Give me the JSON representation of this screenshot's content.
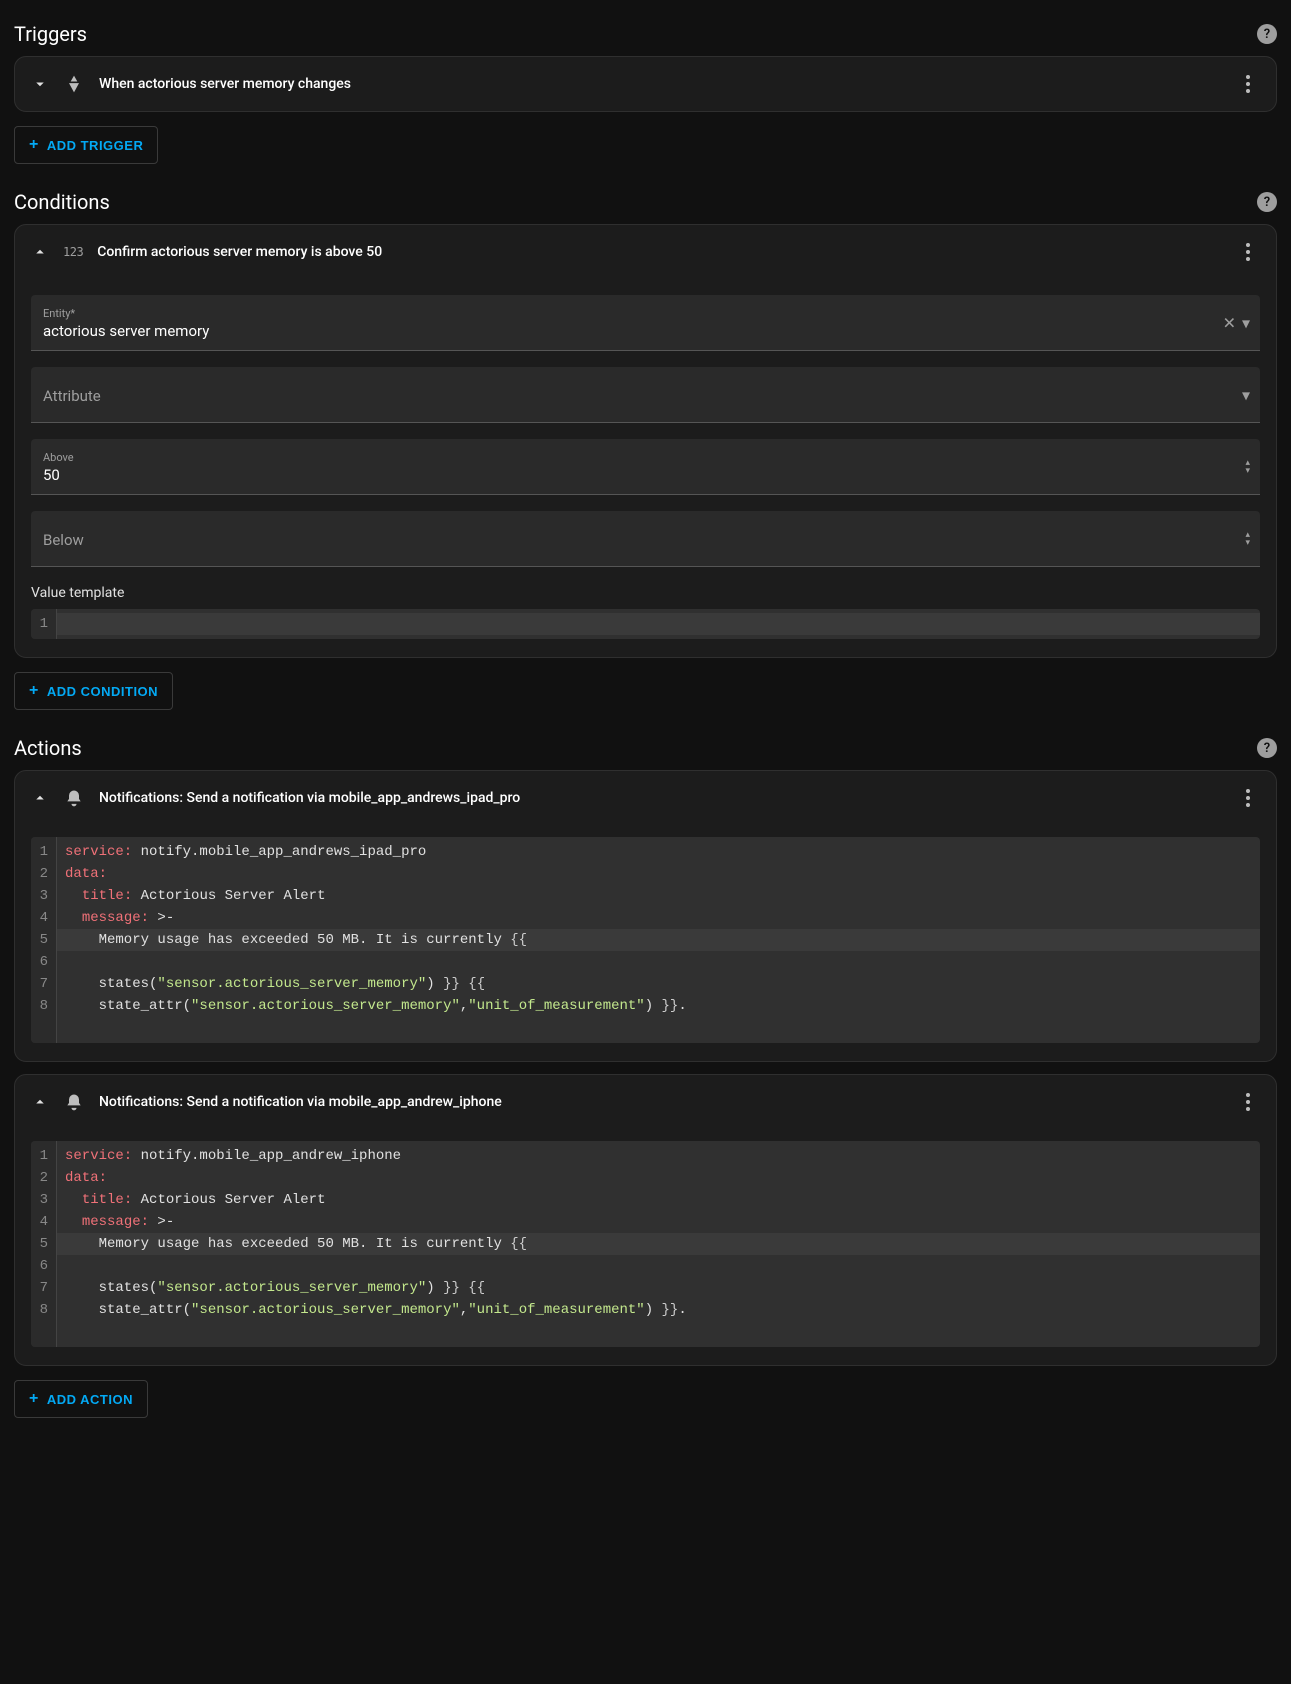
{
  "sections": {
    "triggers": {
      "title": "Triggers",
      "add_label": "ADD TRIGGER"
    },
    "conditions": {
      "title": "Conditions",
      "add_label": "ADD CONDITION"
    },
    "actions": {
      "title": "Actions",
      "add_label": "ADD ACTION"
    }
  },
  "triggers": [
    {
      "title": "When actorious server memory changes",
      "expanded": false
    }
  ],
  "conditions": [
    {
      "title": "Confirm actorious server memory is above 50",
      "expanded": true,
      "entity_label": "Entity*",
      "entity_value": "actorious server memory",
      "attribute_label": "Attribute",
      "attribute_value": "",
      "above_label": "Above",
      "above_value": "50",
      "below_label": "Below",
      "below_value": "",
      "value_template_label": "Value template",
      "value_template_value": ""
    }
  ],
  "actions": [
    {
      "title": "Notifications: Send a notification via mobile_app_andrews_ipad_pro",
      "yaml": {
        "service": "notify.mobile_app_andrews_ipad_pro",
        "title": "Actorious Server Alert",
        "message_prefix": "Memory usage has exceeded 50 MB. It is currently",
        "sensor": "sensor.actorious_server_memory",
        "attr": "unit_of_measurement"
      }
    },
    {
      "title": "Notifications: Send a notification via mobile_app_andrew_iphone",
      "yaml": {
        "service": "notify.mobile_app_andrew_iphone",
        "title": "Actorious Server Alert",
        "message_prefix": "Memory usage has exceeded 50 MB. It is currently",
        "sensor": "sensor.actorious_server_memory",
        "attr": "unit_of_measurement"
      }
    }
  ],
  "icons": {
    "help": "?",
    "plus": "+"
  }
}
